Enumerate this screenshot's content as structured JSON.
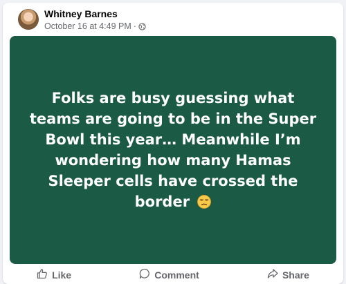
{
  "post": {
    "author": "Whitney Barnes",
    "timestamp": "October 16 at 4:49 PM",
    "separator": "·",
    "audience_icon": "globe-icon",
    "background_color": "#1b5a45",
    "text": "Folks are busy guessing what teams are going to be in the Super Bowl this year… Meanwhile I’m wondering how many Hamas Sleeper cells have crossed the border",
    "emoji_icon": "unamused-face-icon"
  },
  "actions": {
    "like_label": "Like",
    "comment_label": "Comment",
    "share_label": "Share"
  }
}
